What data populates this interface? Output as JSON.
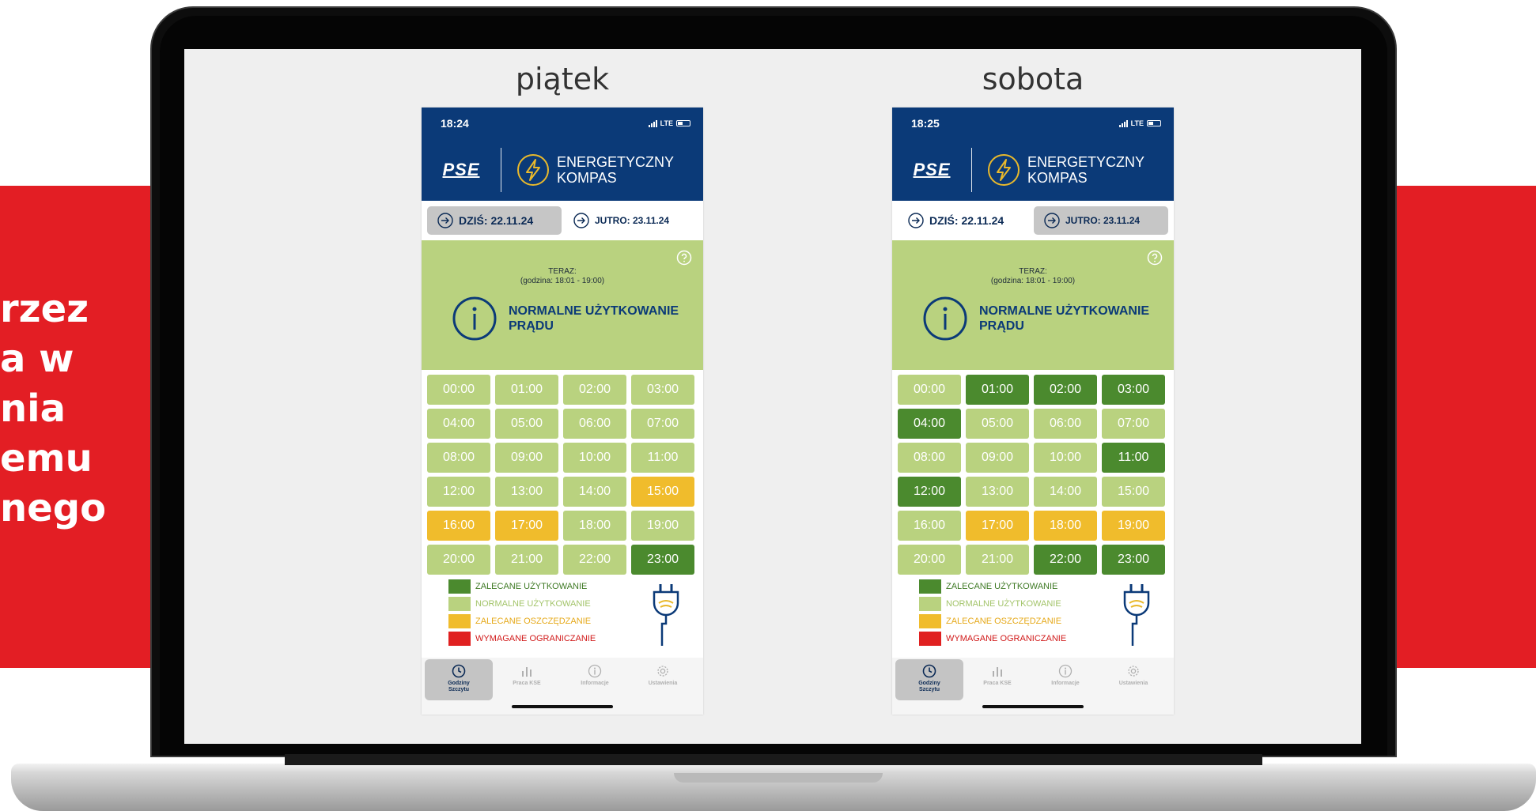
{
  "side_text": "rzez\na w\nnia\nemu\nnego",
  "colors": {
    "red_band": "#e31e24",
    "navy": "#0b3a78",
    "now_bg": "#b9d27f",
    "dark_green": "#4b8a2e",
    "light_green": "#b9d27f",
    "yellow": "#f0bc2c",
    "red": "#e02020"
  },
  "legend": [
    {
      "label": "ZALECANE UŻYTKOWANIE",
      "color": "#4b8a2e",
      "text_color": "#3f7a25"
    },
    {
      "label": "NORMALNE UŻYTKOWANIE",
      "color": "#b9d27f",
      "text_color": "#a3c46a"
    },
    {
      "label": "ZALECANE OSZCZĘDZANIE",
      "color": "#f0bc2c",
      "text_color": "#e6a91a"
    },
    {
      "label": "WYMAGANE OGRANICZANIE",
      "color": "#e02020",
      "text_color": "#d11a1a"
    }
  ],
  "phones": [
    {
      "day_label": "piątek",
      "time": "18:24",
      "network": "LTE",
      "brand": {
        "logo": "PSE",
        "name_line1": "ENERGETYCZNY",
        "name_line2": "KOMPAS"
      },
      "dates": {
        "today": "DZIŚ: 22.11.24",
        "tomorrow": "JUTRO: 23.11.24",
        "active": "today"
      },
      "now": {
        "label": "TERAZ:",
        "range": "(godzina: 18:01 - 19:00)",
        "status_line1": "NORMALNE UŻYTKOWANIE",
        "status_line2": "PRĄDU"
      },
      "hours": [
        {
          "time": "00:00",
          "level": "normal"
        },
        {
          "time": "01:00",
          "level": "normal"
        },
        {
          "time": "02:00",
          "level": "normal"
        },
        {
          "time": "03:00",
          "level": "normal"
        },
        {
          "time": "04:00",
          "level": "normal"
        },
        {
          "time": "05:00",
          "level": "normal"
        },
        {
          "time": "06:00",
          "level": "normal"
        },
        {
          "time": "07:00",
          "level": "normal"
        },
        {
          "time": "08:00",
          "level": "normal"
        },
        {
          "time": "09:00",
          "level": "normal"
        },
        {
          "time": "10:00",
          "level": "normal"
        },
        {
          "time": "11:00",
          "level": "normal"
        },
        {
          "time": "12:00",
          "level": "normal"
        },
        {
          "time": "13:00",
          "level": "normal"
        },
        {
          "time": "14:00",
          "level": "normal"
        },
        {
          "time": "15:00",
          "level": "save"
        },
        {
          "time": "16:00",
          "level": "save"
        },
        {
          "time": "17:00",
          "level": "save"
        },
        {
          "time": "18:00",
          "level": "normal"
        },
        {
          "time": "19:00",
          "level": "normal"
        },
        {
          "time": "20:00",
          "level": "normal"
        },
        {
          "time": "21:00",
          "level": "normal"
        },
        {
          "time": "22:00",
          "level": "normal"
        },
        {
          "time": "23:00",
          "level": "recommended"
        }
      ],
      "tabs": [
        {
          "label": "Godziny Szczytu",
          "icon": "clock-icon",
          "active": true
        },
        {
          "label": "Praca KSE",
          "icon": "bar-chart-icon",
          "active": false
        },
        {
          "label": "Informacje",
          "icon": "info-icon",
          "active": false
        },
        {
          "label": "Ustawienia",
          "icon": "gear-icon",
          "active": false
        }
      ]
    },
    {
      "day_label": "sobota",
      "time": "18:25",
      "network": "LTE",
      "brand": {
        "logo": "PSE",
        "name_line1": "ENERGETYCZNY",
        "name_line2": "KOMPAS"
      },
      "dates": {
        "today": "DZIŚ: 22.11.24",
        "tomorrow": "JUTRO: 23.11.24",
        "active": "tomorrow"
      },
      "now": {
        "label": "TERAZ:",
        "range": "(godzina: 18:01 - 19:00)",
        "status_line1": "NORMALNE UŻYTKOWANIE",
        "status_line2": "PRĄDU"
      },
      "hours": [
        {
          "time": "00:00",
          "level": "normal"
        },
        {
          "time": "01:00",
          "level": "recommended"
        },
        {
          "time": "02:00",
          "level": "recommended"
        },
        {
          "time": "03:00",
          "level": "recommended"
        },
        {
          "time": "04:00",
          "level": "recommended"
        },
        {
          "time": "05:00",
          "level": "normal"
        },
        {
          "time": "06:00",
          "level": "normal"
        },
        {
          "time": "07:00",
          "level": "normal"
        },
        {
          "time": "08:00",
          "level": "normal"
        },
        {
          "time": "09:00",
          "level": "normal"
        },
        {
          "time": "10:00",
          "level": "normal"
        },
        {
          "time": "11:00",
          "level": "recommended"
        },
        {
          "time": "12:00",
          "level": "recommended"
        },
        {
          "time": "13:00",
          "level": "normal"
        },
        {
          "time": "14:00",
          "level": "normal"
        },
        {
          "time": "15:00",
          "level": "normal"
        },
        {
          "time": "16:00",
          "level": "normal"
        },
        {
          "time": "17:00",
          "level": "save"
        },
        {
          "time": "18:00",
          "level": "save"
        },
        {
          "time": "19:00",
          "level": "save"
        },
        {
          "time": "20:00",
          "level": "normal"
        },
        {
          "time": "21:00",
          "level": "normal"
        },
        {
          "time": "22:00",
          "level": "recommended"
        },
        {
          "time": "23:00",
          "level": "recommended"
        }
      ],
      "tabs": [
        {
          "label": "Godziny Szczytu",
          "icon": "clock-icon",
          "active": true
        },
        {
          "label": "Praca KSE",
          "icon": "bar-chart-icon",
          "active": false
        },
        {
          "label": "Informacje",
          "icon": "info-icon",
          "active": false
        },
        {
          "label": "Ustawienia",
          "icon": "gear-icon",
          "active": false
        }
      ]
    }
  ]
}
